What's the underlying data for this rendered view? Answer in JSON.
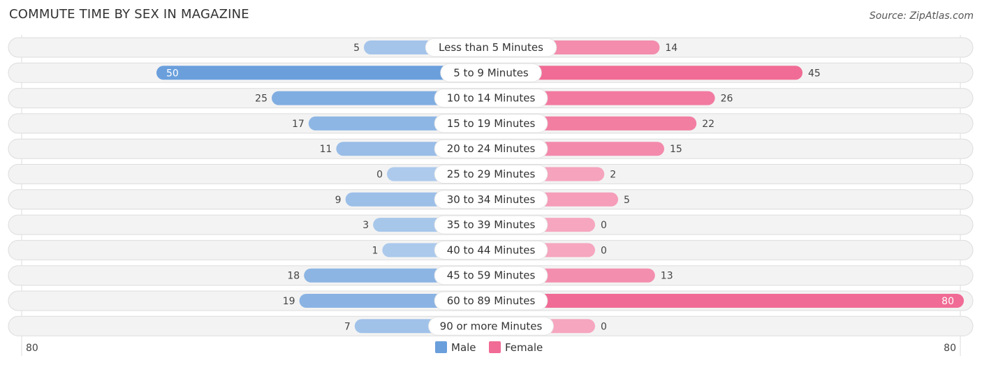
{
  "header": {
    "title": "COMMUTE TIME BY SEX IN MAGAZINE",
    "source": "Source: ZipAtlas.com"
  },
  "chart_data": {
    "type": "bar",
    "orientation": "horizontal-diverging",
    "title": "COMMUTE TIME BY SEX IN MAGAZINE",
    "categories": [
      "Less than 5 Minutes",
      "5 to 9 Minutes",
      "10 to 14 Minutes",
      "15 to 19 Minutes",
      "20 to 24 Minutes",
      "25 to 29 Minutes",
      "30 to 34 Minutes",
      "35 to 39 Minutes",
      "40 to 44 Minutes",
      "45 to 59 Minutes",
      "60 to 89 Minutes",
      "90 or more Minutes"
    ],
    "series": [
      {
        "name": "Male",
        "color": "#6a9fdc",
        "values": [
          5,
          50,
          25,
          17,
          11,
          0,
          9,
          3,
          1,
          18,
          19,
          7
        ]
      },
      {
        "name": "Female",
        "color": "#f06b95",
        "values": [
          14,
          45,
          26,
          22,
          15,
          2,
          5,
          0,
          0,
          13,
          80,
          0
        ]
      }
    ],
    "axis": {
      "left_label": "80",
      "right_label": "80",
      "max": 80
    },
    "legend": {
      "position": "bottom-center",
      "items": [
        "Male",
        "Female"
      ]
    }
  }
}
